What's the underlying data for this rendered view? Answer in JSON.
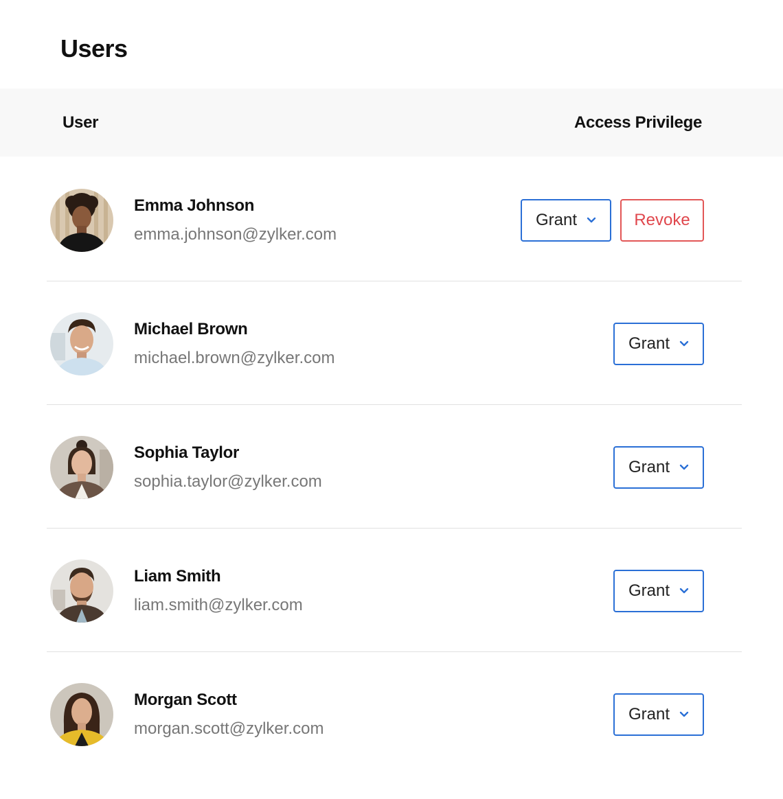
{
  "page": {
    "title": "Users"
  },
  "table": {
    "columns": {
      "user": "User",
      "access": "Access Privilege"
    },
    "rows": [
      {
        "name": "Emma Johnson",
        "email": "emma.johnson@zylker.com",
        "grant_label": "Grant",
        "revoke_label": "Revoke"
      },
      {
        "name": "Michael Brown",
        "email": "michael.brown@zylker.com",
        "grant_label": "Grant"
      },
      {
        "name": "Sophia Taylor",
        "email": "sophia.taylor@zylker.com",
        "grant_label": "Grant"
      },
      {
        "name": "Liam Smith",
        "email": "liam.smith@zylker.com",
        "grant_label": "Grant"
      },
      {
        "name": "Morgan Scott",
        "email": "morgan.scott@zylker.com",
        "grant_label": "Grant"
      }
    ]
  },
  "colors": {
    "accent_blue": "#2a6fd6",
    "revoke_red": "#e0474d",
    "header_bg": "#f8f8f8",
    "email_gray": "#777777"
  }
}
